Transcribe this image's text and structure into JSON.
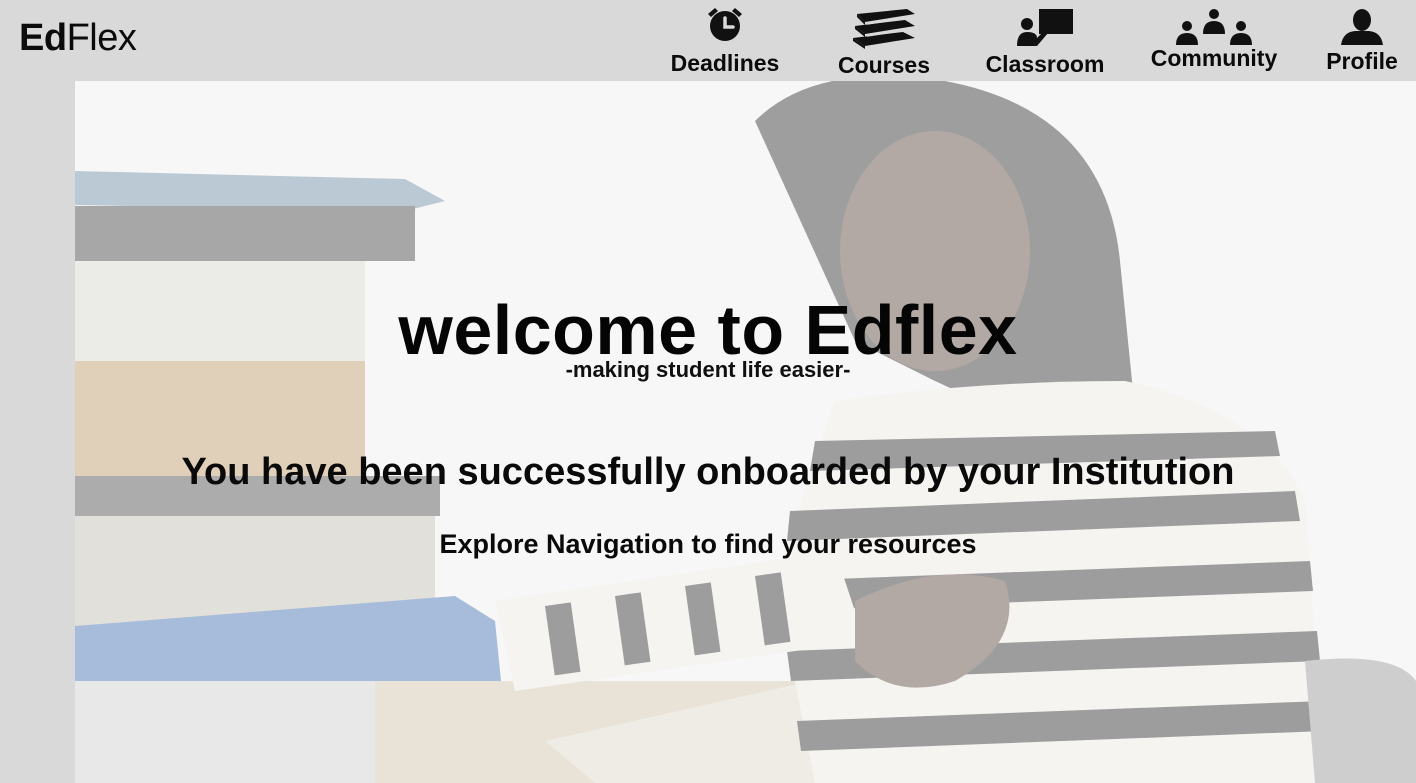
{
  "brand": {
    "bold": "Ed",
    "light": "Flex"
  },
  "nav": {
    "items": [
      {
        "label": "Deadlines",
        "icon": "alarm-clock-icon"
      },
      {
        "label": "Courses",
        "icon": "books-icon"
      },
      {
        "label": "Classroom",
        "icon": "classroom-icon"
      },
      {
        "label": "Community",
        "icon": "community-icon"
      },
      {
        "label": "Profile",
        "icon": "profile-icon"
      }
    ]
  },
  "hero": {
    "title": "welcome to Edflex",
    "tagline": "-making student life easier-",
    "message": "You have been successfully onboarded by your Institution",
    "hint": "Explore Navigation to  find your resources",
    "image": "student-reading-photo"
  },
  "colors": {
    "topbar": "#d9d9d9",
    "text": "#0b0b0b"
  }
}
